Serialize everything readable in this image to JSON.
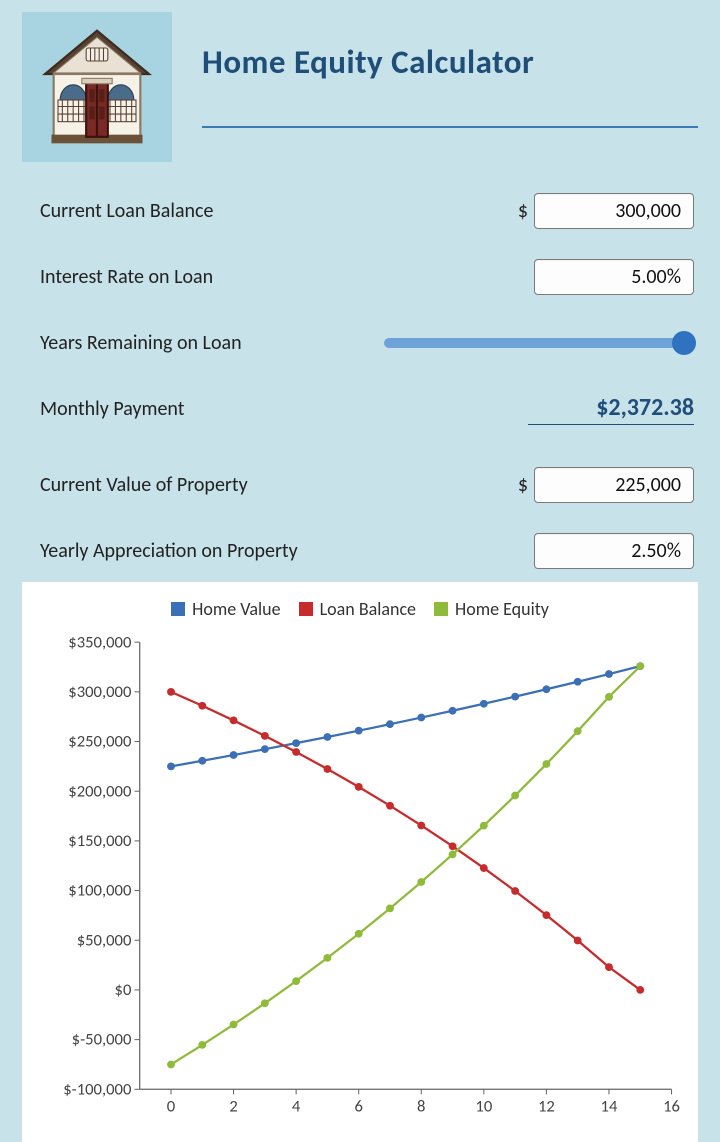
{
  "title": "Home Equity Calculator",
  "colors": {
    "home_value": "#3b6fb6",
    "loan_balance": "#c82b2b",
    "home_equity": "#8fbb3b"
  },
  "form": {
    "loan_balance": {
      "label": "Current Loan Balance",
      "prefix": "$",
      "value": "300,000"
    },
    "interest_rate": {
      "label": "Interest Rate on Loan",
      "value": "5.00%"
    },
    "years_remaining": {
      "label": "Years Remaining on Loan"
    },
    "monthly_payment": {
      "label": "Monthly Payment",
      "value": "$2,372.38"
    },
    "property_value": {
      "label": "Current Value of Property",
      "prefix": "$",
      "value": "225,000"
    },
    "appreciation": {
      "label": "Yearly Appreciation on Property",
      "value": "2.50%"
    }
  },
  "legend": {
    "home_value": "Home Value",
    "loan_balance": "Loan Balance",
    "home_equity": "Home Equity"
  },
  "chart_data": {
    "type": "line",
    "xlabel": "",
    "ylabel": "",
    "xlim": [
      -1,
      16
    ],
    "ylim": [
      -100000,
      350000
    ],
    "x_ticks": [
      0,
      2,
      4,
      6,
      8,
      10,
      12,
      14,
      16
    ],
    "y_ticks": [
      -100000,
      -50000,
      0,
      50000,
      100000,
      150000,
      200000,
      250000,
      300000,
      350000
    ],
    "y_tick_labels": [
      "$-100,000",
      "$-50,000",
      "$0",
      "$50,000",
      "$100,000",
      "$150,000",
      "$200,000",
      "$250,000",
      "$300,000",
      "$350,000"
    ],
    "x": [
      0,
      1,
      2,
      3,
      4,
      5,
      6,
      7,
      8,
      9,
      10,
      11,
      12,
      13,
      14,
      15
    ],
    "series": [
      {
        "name": "Home Value",
        "color": "#3b6fb6",
        "values": [
          225000,
          230625,
          236391,
          242300,
          248358,
          254567,
          260931,
          267454,
          274141,
          280994,
          288019,
          295220,
          302600,
          310165,
          317919,
          325867
        ]
      },
      {
        "name": "Loan Balance",
        "color": "#c82b2b",
        "values": [
          300000,
          285976,
          271234,
          255739,
          239451,
          222330,
          204334,
          185417,
          165531,
          144627,
          122653,
          99554,
          75274,
          49752,
          22926,
          0
        ]
      },
      {
        "name": "Home Equity",
        "color": "#8fbb3b",
        "values": [
          -75000,
          -55351,
          -34844,
          -13438,
          8907,
          32237,
          56597,
          82037,
          108609,
          136367,
          165366,
          195665,
          227326,
          260413,
          294993,
          325867
        ]
      }
    ]
  }
}
